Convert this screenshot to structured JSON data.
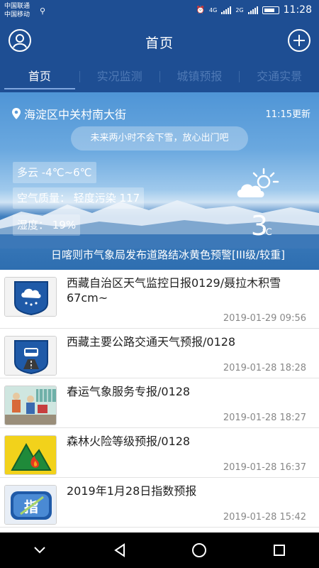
{
  "status_bar": {
    "carrier_1": "中国联通",
    "carrier_2": "中国移动",
    "network_1": "4G",
    "network_2": "2G",
    "time": "11:28"
  },
  "header": {
    "title": "首页",
    "avatar_icon": "user-avatar-icon",
    "add_icon": "plus-circle-icon"
  },
  "tabs": [
    {
      "label": "首页",
      "active": true
    },
    {
      "label": "实况监测",
      "active": false
    },
    {
      "label": "城镇预报",
      "active": false
    },
    {
      "label": "交通实景",
      "active": false
    }
  ],
  "weather": {
    "location": "海淀区中关村南大街",
    "update_time": "11:15更新",
    "forecast_tip": "未来两小时不会下雪，放心出门吧",
    "condition": "多云 -4℃~6℃",
    "air_quality": "空气质量：  轻度污染 117",
    "humidity": "湿度：  19%",
    "temperature": "3",
    "temperature_unit": "℃",
    "alert": "日喀则市气象局发布道路结冰黄色预警[III级/较重]"
  },
  "news": [
    {
      "title": "西藏自治区天气监控日报0129/聂拉木积雪67cm~",
      "date": "2019-01-29 09:56",
      "icon": "snow-cloud-icon"
    },
    {
      "title": "西藏主要公路交通天气预报/0128",
      "date": "2019-01-28 18:28",
      "icon": "road-car-icon"
    },
    {
      "title": "春运气象服务专报/0128",
      "date": "2019-01-28 18:27",
      "icon": "travelers-photo"
    },
    {
      "title": "森林火险等级预报/0128",
      "date": "2019-01-28 16:37",
      "icon": "forest-fire-icon"
    },
    {
      "title": "2019年1月28日指数预报",
      "date": "2019-01-28 15:42",
      "icon": "index-icon"
    }
  ],
  "thumb_text": {
    "index": "指"
  },
  "colors": {
    "primary": "#1e4e93",
    "tab_inactive": "#4f79b5",
    "text_dark": "#222222",
    "text_muted": "#888888"
  }
}
